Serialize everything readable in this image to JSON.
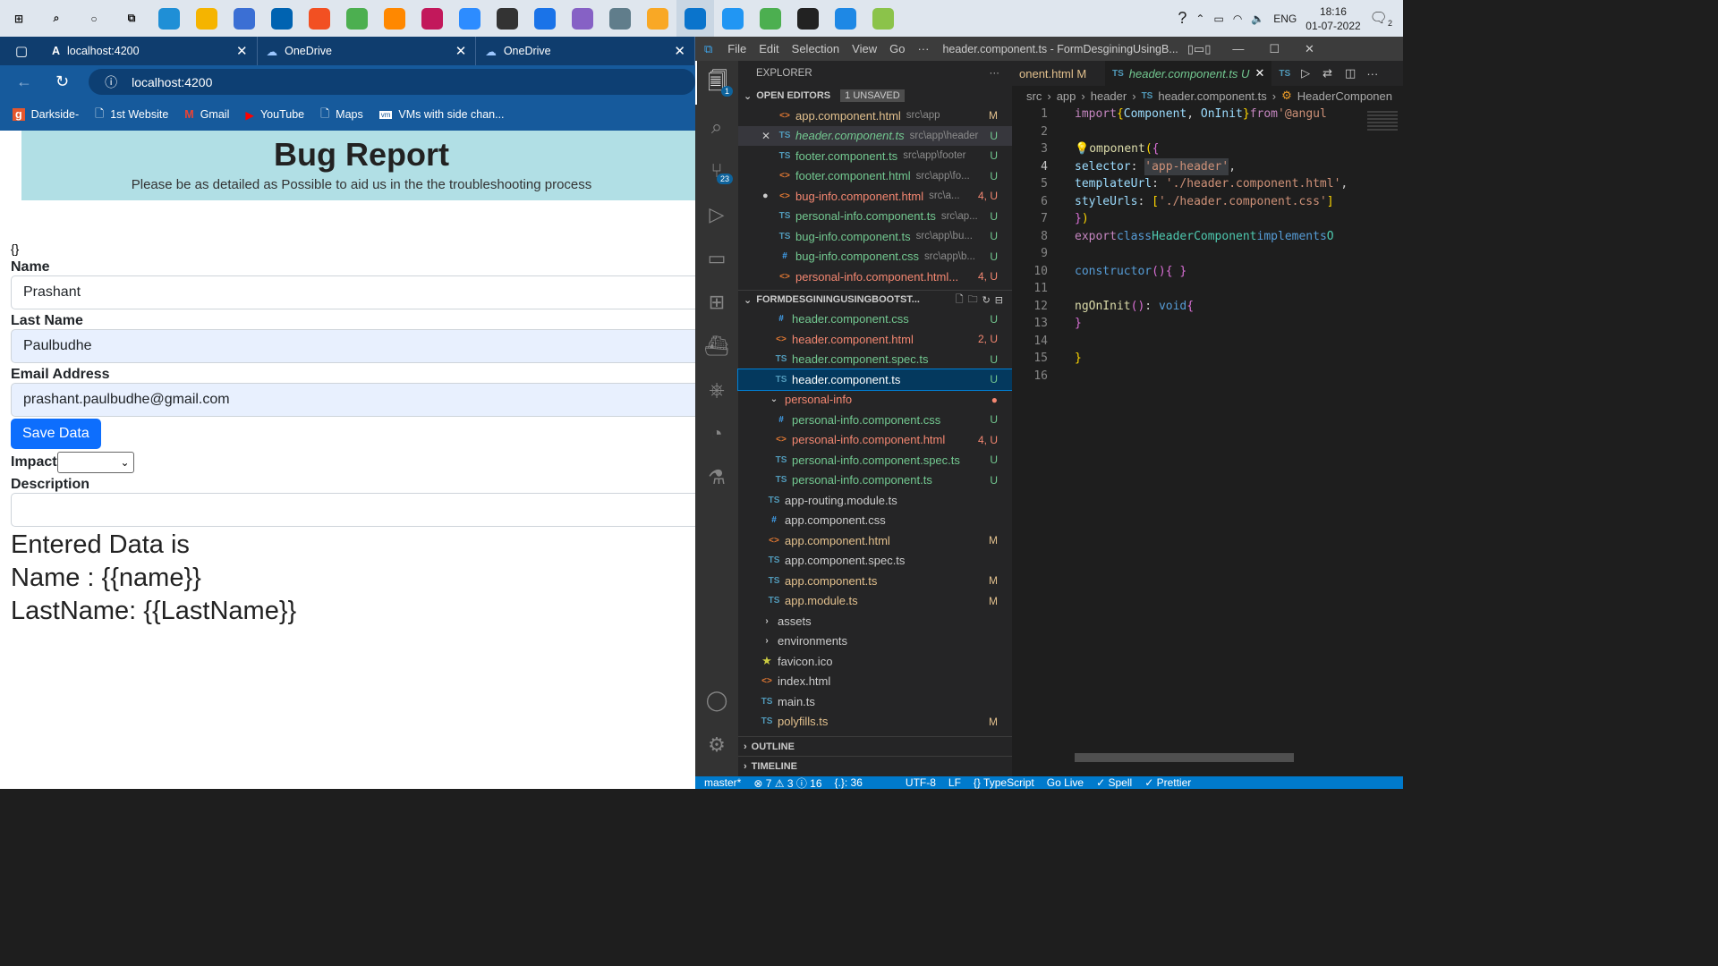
{
  "taskbar": {
    "icons": [
      "windows-icon",
      "search-icon",
      "cortana-icon",
      "task-view-icon",
      "edge-icon",
      "file-explorer-icon",
      "store-icon",
      "mail-icon",
      "brave-icon",
      "chrome-icon",
      "vlc-icon",
      "intellij-icon",
      "zoom-icon",
      "obs-icon",
      "teams-icon",
      "visual-studio-icon",
      "app-icon",
      "folder-app-icon",
      "vscode-icon",
      "git-app-icon",
      "atom-icon",
      "terminal-icon",
      "photos-icon",
      "paint-icon"
    ],
    "lang": "ENG",
    "time": "18:16",
    "date": "01-07-2022",
    "notif_count": "2"
  },
  "browser": {
    "tabs": [
      {
        "label": "localhost:4200"
      },
      {
        "label": "OneDrive"
      },
      {
        "label": "OneDrive"
      }
    ],
    "url": "localhost:4200",
    "bookmarks": [
      "Darkside-",
      "1st Website",
      "Gmail",
      "YouTube",
      "Maps",
      "VMs with side chan..."
    ]
  },
  "page": {
    "title": "Bug Report",
    "subtitle": "Please be as detailed as Possible to aid us in the the troubleshooting process",
    "braces": "{}",
    "name_label": "Name",
    "name_value": "Prashant",
    "lastname_label": "Last Name",
    "lastname_value": "Paulbudhe",
    "email_label": "Email Address",
    "email_value": "prashant.paulbudhe@gmail.com",
    "save_label": "Save Data",
    "impact_label": "Impact",
    "description_label": "Description",
    "entered_heading": "Entered Data is",
    "name_out": "Name : {{name}}",
    "lastname_out": "LastName: {{LastName}}"
  },
  "vscode": {
    "menu": [
      "File",
      "Edit",
      "Selection",
      "View",
      "Go",
      "···"
    ],
    "window_title": "header.component.ts - FormDesginingUsingB...",
    "explorer_title": "EXPLORER",
    "open_editors": "OPEN EDITORS",
    "unsaved": "1 UNSAVED",
    "open_files": [
      {
        "icon": "<>",
        "cls": "htm",
        "name": "app.component.html",
        "path": "src\\app",
        "status": "M",
        "scls": "mod"
      },
      {
        "icon": "TS",
        "cls": "ts",
        "name": "header.component.ts",
        "path": "src\\app\\header",
        "status": "U",
        "scls": "unt"
      },
      {
        "icon": "TS",
        "cls": "ts",
        "name": "footer.component.ts",
        "path": "src\\app\\footer",
        "status": "U",
        "scls": "unt"
      },
      {
        "icon": "<>",
        "cls": "htm",
        "name": "footer.component.html",
        "path": "src\\app\\fo...",
        "status": "U",
        "scls": "unt"
      },
      {
        "icon": "<>",
        "cls": "htm",
        "name": "bug-info.component.html",
        "path": "src\\a...",
        "status": "4, U",
        "scls": "err"
      },
      {
        "icon": "TS",
        "cls": "ts",
        "name": "personal-info.component.ts",
        "path": "src\\ap...",
        "status": "U",
        "scls": "unt"
      },
      {
        "icon": "TS",
        "cls": "ts",
        "name": "bug-info.component.ts",
        "path": "src\\app\\bu...",
        "status": "U",
        "scls": "unt"
      },
      {
        "icon": "#",
        "cls": "css",
        "name": "bug-info.component.css",
        "path": "src\\app\\b...",
        "status": "U",
        "scls": "unt"
      },
      {
        "icon": "<>",
        "cls": "htm",
        "name": "personal-info.component.html...",
        "path": "",
        "status": "4, U",
        "scls": "err"
      }
    ],
    "project": "FORMDESGININGUSINGBOOTST...",
    "tree": [
      {
        "icon": "#",
        "cls": "css",
        "name": "header.component.css",
        "status": "U",
        "scls": "unt",
        "indent": 40
      },
      {
        "icon": "<>",
        "cls": "htm",
        "name": "header.component.html",
        "status": "2, U",
        "scls": "err",
        "indent": 40
      },
      {
        "icon": "TS",
        "cls": "ts",
        "name": "header.component.spec.ts",
        "status": "U",
        "scls": "unt",
        "indent": 40
      },
      {
        "icon": "TS",
        "cls": "ts",
        "name": "header.component.ts",
        "status": "U",
        "scls": "unt",
        "indent": 40
      },
      {
        "icon": "⌄",
        "cls": "",
        "name": "personal-info",
        "status": "●",
        "scls": "err",
        "indent": 32
      },
      {
        "icon": "#",
        "cls": "css",
        "name": "personal-info.component.css",
        "status": "U",
        "scls": "unt",
        "indent": 40
      },
      {
        "icon": "<>",
        "cls": "htm",
        "name": "personal-info.component.html",
        "status": "4, U",
        "scls": "err",
        "indent": 40
      },
      {
        "icon": "TS",
        "cls": "ts",
        "name": "personal-info.component.spec.ts",
        "status": "U",
        "scls": "unt",
        "indent": 40
      },
      {
        "icon": "TS",
        "cls": "ts",
        "name": "personal-info.component.ts",
        "status": "U",
        "scls": "unt",
        "indent": 40
      },
      {
        "icon": "TS",
        "cls": "ts",
        "name": "app-routing.module.ts",
        "status": "",
        "scls": "",
        "indent": 32
      },
      {
        "icon": "#",
        "cls": "css",
        "name": "app.component.css",
        "status": "",
        "scls": "",
        "indent": 32
      },
      {
        "icon": "<>",
        "cls": "htm",
        "name": "app.component.html",
        "status": "M",
        "scls": "mod",
        "indent": 32
      },
      {
        "icon": "TS",
        "cls": "ts",
        "name": "app.component.spec.ts",
        "status": "",
        "scls": "",
        "indent": 32
      },
      {
        "icon": "TS",
        "cls": "ts",
        "name": "app.component.ts",
        "status": "M",
        "scls": "mod",
        "indent": 32
      },
      {
        "icon": "TS",
        "cls": "ts",
        "name": "app.module.ts",
        "status": "M",
        "scls": "mod",
        "indent": 32
      },
      {
        "icon": "›",
        "cls": "",
        "name": "assets",
        "status": "",
        "scls": "",
        "indent": 24
      },
      {
        "icon": "›",
        "cls": "",
        "name": "environments",
        "status": "",
        "scls": "",
        "indent": 24
      },
      {
        "icon": "★",
        "cls": "",
        "name": "favicon.ico",
        "status": "",
        "scls": "",
        "indent": 24
      },
      {
        "icon": "<>",
        "cls": "htm",
        "name": "index.html",
        "status": "",
        "scls": "",
        "indent": 24
      },
      {
        "icon": "TS",
        "cls": "ts",
        "name": "main.ts",
        "status": "",
        "scls": "",
        "indent": 24
      },
      {
        "icon": "TS",
        "cls": "ts",
        "name": "polyfills.ts",
        "status": "M",
        "scls": "mod",
        "indent": 24
      }
    ],
    "outline": "OUTLINE",
    "timeline": "TIMELINE",
    "editor_tabs": [
      "onent.html M",
      "header.component.ts U",
      "TS"
    ],
    "breadcrumb": [
      "src",
      "app",
      "header",
      "header.component.ts",
      "HeaderComponen"
    ],
    "status_items": [
      "master*",
      "⊗ 7 ⚠ 3 ⓘ 16",
      "{.}: 36",
      "UTF-8",
      "LF",
      "{} TypeScript",
      "Go Live",
      "✓ Spell",
      "✓ Prettier"
    ]
  }
}
